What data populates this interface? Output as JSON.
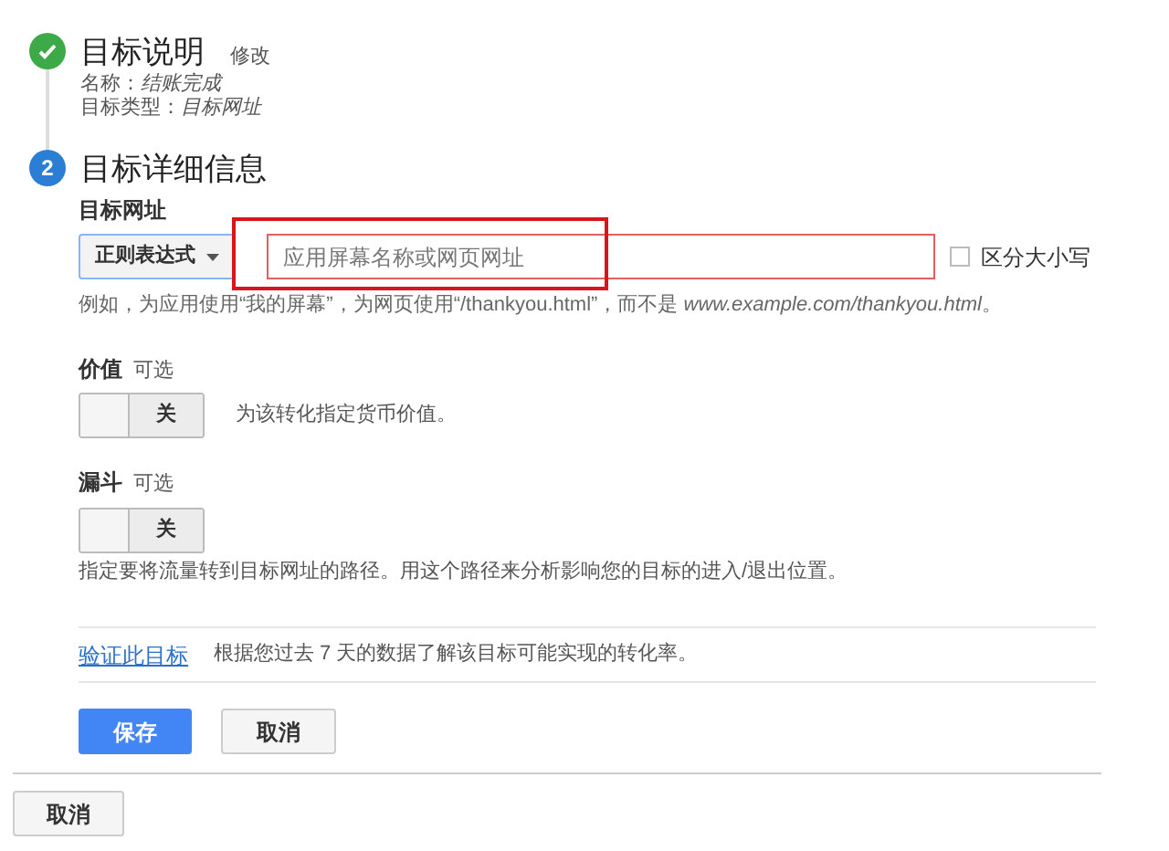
{
  "steps": [
    {
      "done": true,
      "title": "目标说明",
      "edit_link": "修改",
      "details": [
        {
          "label": "名称：",
          "value": "结账完成"
        },
        {
          "label": "目标类型：",
          "value": "目标网址"
        }
      ]
    },
    {
      "number": "2",
      "done": false,
      "title": "目标详细信息"
    }
  ],
  "destination": {
    "label": "目标网址",
    "match_type": "正则表达式",
    "placeholder": "应用屏幕名称或网页网址",
    "case_sensitive": {
      "label": "区分大小写",
      "checked": false
    },
    "hint": "例如，为应用使用“我的屏幕”，为网页使用“/thankyou.html”，而不是 *www.example.com/thankyou.html*。"
  },
  "options": [
    {
      "label": "价值",
      "optional": "可选",
      "toggle": "关",
      "on": false,
      "description": "为该转化指定货币价值。",
      "inline": true
    },
    {
      "label": "漏斗",
      "optional": "可选",
      "toggle": "关",
      "on": false,
      "description": "指定要将流量转到目标网址的路径。用这个路径来分析影响您的目标的进入/退出位置。",
      "inline": false
    }
  ],
  "verify": {
    "link": "验证此目标",
    "text": "根据您过去 7 天的数据了解该目标可能实现的转化率。"
  },
  "buttons": [
    {
      "label": "保存",
      "primary": true
    },
    {
      "label": "取消",
      "primary": false
    }
  ],
  "footer_button": "取消"
}
